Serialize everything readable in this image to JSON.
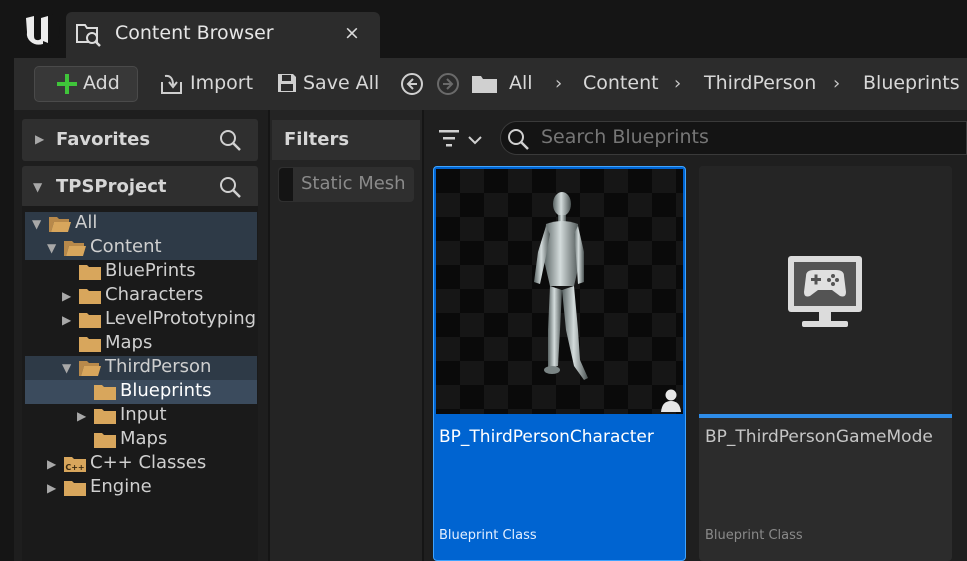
{
  "window": {
    "tab_title": "Content Browser",
    "close_glyph": "×",
    "icons": {
      "logo": "unreal-logo-icon",
      "tab": "content-browser-icon"
    }
  },
  "toolbar": {
    "add_label": "Add",
    "import_label": "Import",
    "save_all_label": "Save All"
  },
  "breadcrumb": [
    "All",
    "Content",
    "ThirdPerson",
    "Blueprints"
  ],
  "sources": {
    "favorites_label": "Favorites",
    "project_label": "TPSProject",
    "tree": [
      {
        "label": "All",
        "depth": 0,
        "arrow": "down",
        "folder": "open",
        "selected": "soft"
      },
      {
        "label": "Content",
        "depth": 1,
        "arrow": "down",
        "folder": "open",
        "selected": "soft"
      },
      {
        "label": "BluePrints",
        "depth": 2,
        "arrow": "none",
        "folder": "closed",
        "selected": ""
      },
      {
        "label": "Characters",
        "depth": 2,
        "arrow": "right",
        "folder": "closed",
        "selected": ""
      },
      {
        "label": "LevelPrototyping",
        "depth": 2,
        "arrow": "right",
        "folder": "closed",
        "selected": ""
      },
      {
        "label": "Maps",
        "depth": 2,
        "arrow": "none",
        "folder": "closed",
        "selected": ""
      },
      {
        "label": "ThirdPerson",
        "depth": 2,
        "arrow": "down",
        "folder": "open",
        "selected": "soft"
      },
      {
        "label": "Blueprints",
        "depth": 3,
        "arrow": "none",
        "folder": "closed",
        "selected": "strong"
      },
      {
        "label": "Input",
        "depth": 3,
        "arrow": "right",
        "folder": "closed",
        "selected": ""
      },
      {
        "label": "Maps",
        "depth": 3,
        "arrow": "none",
        "folder": "closed",
        "selected": ""
      },
      {
        "label": "C++ Classes",
        "depth": 1,
        "arrow": "right",
        "folder": "cpp",
        "selected": ""
      },
      {
        "label": "Engine",
        "depth": 1,
        "arrow": "right",
        "folder": "closed",
        "selected": ""
      }
    ]
  },
  "filters": {
    "title": "Filters",
    "chip": "Static Mesh"
  },
  "search": {
    "placeholder": "Search Blueprints"
  },
  "assets": [
    {
      "name": "BP_ThirdPersonCharacter",
      "type": "Blueprint Class",
      "selected": true,
      "thumb_icon": "mannequin-thumbnail",
      "badge_icon": "character-icon"
    },
    {
      "name": "BP_ThirdPersonGameMode",
      "type": "Blueprint Class",
      "selected": false,
      "thumb_icon": "game-mode-monitor-icon"
    }
  ],
  "colors": {
    "accent": "#0064d1",
    "folder": "#d8a65c",
    "panel": "#2c2c2c"
  }
}
